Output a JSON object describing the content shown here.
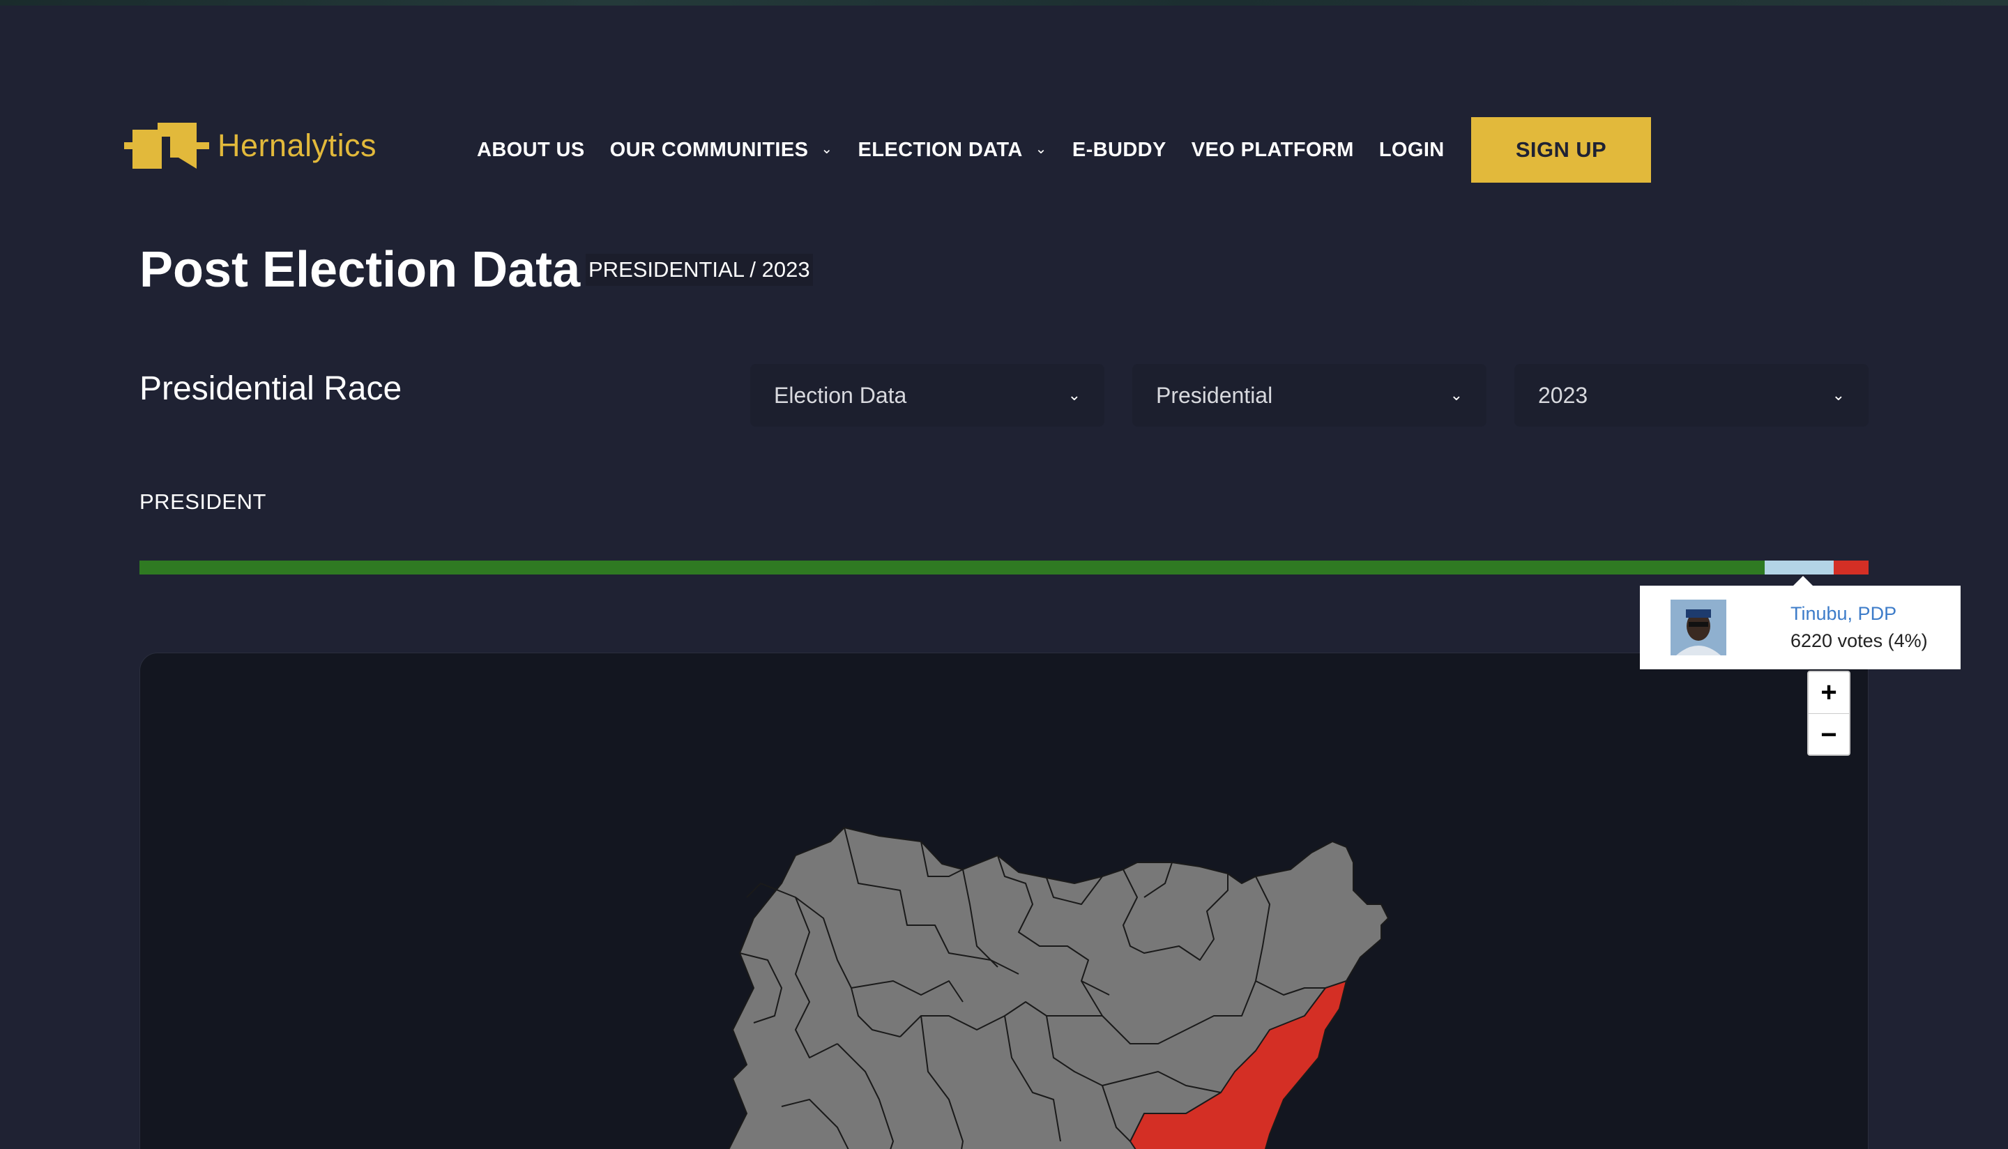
{
  "brand": {
    "name": "Hernalytics",
    "color": "#e2b93b"
  },
  "nav": {
    "items": [
      {
        "label": "ABOUT US",
        "dropdown": false
      },
      {
        "label": "OUR COMMUNITIES",
        "dropdown": true
      },
      {
        "label": "ELECTION DATA",
        "dropdown": true
      },
      {
        "label": "E-BUDDY",
        "dropdown": false
      },
      {
        "label": "VEO PLATFORM",
        "dropdown": false
      },
      {
        "label": "LOGIN",
        "dropdown": false
      }
    ],
    "signup_label": "SIGN UP",
    "chevron_icon": "chevron-down-icon"
  },
  "page": {
    "title": "Post Election Data",
    "breadcrumb": "PRESIDENTIAL / 2023",
    "race_title": "Presidential Race",
    "section_label": "PRESIDENT"
  },
  "filters": [
    {
      "value": "Election Data"
    },
    {
      "value": "Presidential"
    },
    {
      "value": "2023"
    }
  ],
  "results_bar": {
    "segments": [
      {
        "share": 0.94,
        "color": "#2f7a22"
      },
      {
        "share": 0.04,
        "color": "#b3d4e6"
      },
      {
        "share": 0.02,
        "color": "#d42f25"
      }
    ]
  },
  "tooltip": {
    "name": "Tinubu, PDP",
    "votes": "6220 votes (4%)"
  },
  "zoom": {
    "in": "+",
    "out": "−"
  },
  "map": {
    "default_color": "#787878",
    "highlight_color": "#d42f25"
  }
}
